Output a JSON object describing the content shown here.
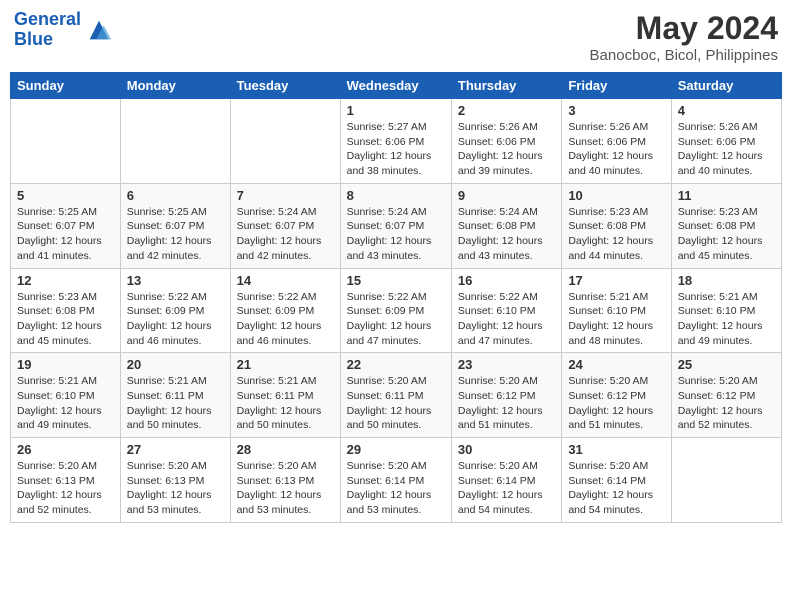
{
  "header": {
    "logo_line1": "General",
    "logo_line2": "Blue",
    "main_title": "May 2024",
    "subtitle": "Banocboc, Bicol, Philippines"
  },
  "calendar": {
    "days_of_week": [
      "Sunday",
      "Monday",
      "Tuesday",
      "Wednesday",
      "Thursday",
      "Friday",
      "Saturday"
    ],
    "weeks": [
      [
        {
          "day": "",
          "info": ""
        },
        {
          "day": "",
          "info": ""
        },
        {
          "day": "",
          "info": ""
        },
        {
          "day": "1",
          "info": "Sunrise: 5:27 AM\nSunset: 6:06 PM\nDaylight: 12 hours\nand 38 minutes."
        },
        {
          "day": "2",
          "info": "Sunrise: 5:26 AM\nSunset: 6:06 PM\nDaylight: 12 hours\nand 39 minutes."
        },
        {
          "day": "3",
          "info": "Sunrise: 5:26 AM\nSunset: 6:06 PM\nDaylight: 12 hours\nand 40 minutes."
        },
        {
          "day": "4",
          "info": "Sunrise: 5:26 AM\nSunset: 6:06 PM\nDaylight: 12 hours\nand 40 minutes."
        }
      ],
      [
        {
          "day": "5",
          "info": "Sunrise: 5:25 AM\nSunset: 6:07 PM\nDaylight: 12 hours\nand 41 minutes."
        },
        {
          "day": "6",
          "info": "Sunrise: 5:25 AM\nSunset: 6:07 PM\nDaylight: 12 hours\nand 42 minutes."
        },
        {
          "day": "7",
          "info": "Sunrise: 5:24 AM\nSunset: 6:07 PM\nDaylight: 12 hours\nand 42 minutes."
        },
        {
          "day": "8",
          "info": "Sunrise: 5:24 AM\nSunset: 6:07 PM\nDaylight: 12 hours\nand 43 minutes."
        },
        {
          "day": "9",
          "info": "Sunrise: 5:24 AM\nSunset: 6:08 PM\nDaylight: 12 hours\nand 43 minutes."
        },
        {
          "day": "10",
          "info": "Sunrise: 5:23 AM\nSunset: 6:08 PM\nDaylight: 12 hours\nand 44 minutes."
        },
        {
          "day": "11",
          "info": "Sunrise: 5:23 AM\nSunset: 6:08 PM\nDaylight: 12 hours\nand 45 minutes."
        }
      ],
      [
        {
          "day": "12",
          "info": "Sunrise: 5:23 AM\nSunset: 6:08 PM\nDaylight: 12 hours\nand 45 minutes."
        },
        {
          "day": "13",
          "info": "Sunrise: 5:22 AM\nSunset: 6:09 PM\nDaylight: 12 hours\nand 46 minutes."
        },
        {
          "day": "14",
          "info": "Sunrise: 5:22 AM\nSunset: 6:09 PM\nDaylight: 12 hours\nand 46 minutes."
        },
        {
          "day": "15",
          "info": "Sunrise: 5:22 AM\nSunset: 6:09 PM\nDaylight: 12 hours\nand 47 minutes."
        },
        {
          "day": "16",
          "info": "Sunrise: 5:22 AM\nSunset: 6:10 PM\nDaylight: 12 hours\nand 47 minutes."
        },
        {
          "day": "17",
          "info": "Sunrise: 5:21 AM\nSunset: 6:10 PM\nDaylight: 12 hours\nand 48 minutes."
        },
        {
          "day": "18",
          "info": "Sunrise: 5:21 AM\nSunset: 6:10 PM\nDaylight: 12 hours\nand 49 minutes."
        }
      ],
      [
        {
          "day": "19",
          "info": "Sunrise: 5:21 AM\nSunset: 6:10 PM\nDaylight: 12 hours\nand 49 minutes."
        },
        {
          "day": "20",
          "info": "Sunrise: 5:21 AM\nSunset: 6:11 PM\nDaylight: 12 hours\nand 50 minutes."
        },
        {
          "day": "21",
          "info": "Sunrise: 5:21 AM\nSunset: 6:11 PM\nDaylight: 12 hours\nand 50 minutes."
        },
        {
          "day": "22",
          "info": "Sunrise: 5:20 AM\nSunset: 6:11 PM\nDaylight: 12 hours\nand 50 minutes."
        },
        {
          "day": "23",
          "info": "Sunrise: 5:20 AM\nSunset: 6:12 PM\nDaylight: 12 hours\nand 51 minutes."
        },
        {
          "day": "24",
          "info": "Sunrise: 5:20 AM\nSunset: 6:12 PM\nDaylight: 12 hours\nand 51 minutes."
        },
        {
          "day": "25",
          "info": "Sunrise: 5:20 AM\nSunset: 6:12 PM\nDaylight: 12 hours\nand 52 minutes."
        }
      ],
      [
        {
          "day": "26",
          "info": "Sunrise: 5:20 AM\nSunset: 6:13 PM\nDaylight: 12 hours\nand 52 minutes."
        },
        {
          "day": "27",
          "info": "Sunrise: 5:20 AM\nSunset: 6:13 PM\nDaylight: 12 hours\nand 53 minutes."
        },
        {
          "day": "28",
          "info": "Sunrise: 5:20 AM\nSunset: 6:13 PM\nDaylight: 12 hours\nand 53 minutes."
        },
        {
          "day": "29",
          "info": "Sunrise: 5:20 AM\nSunset: 6:14 PM\nDaylight: 12 hours\nand 53 minutes."
        },
        {
          "day": "30",
          "info": "Sunrise: 5:20 AM\nSunset: 6:14 PM\nDaylight: 12 hours\nand 54 minutes."
        },
        {
          "day": "31",
          "info": "Sunrise: 5:20 AM\nSunset: 6:14 PM\nDaylight: 12 hours\nand 54 minutes."
        },
        {
          "day": "",
          "info": ""
        }
      ]
    ]
  }
}
